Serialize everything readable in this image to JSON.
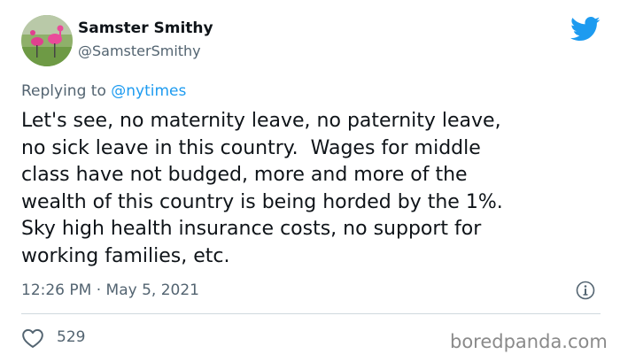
{
  "user": {
    "display_name": "Samster Smithy",
    "handle": "@SamsterSmithy"
  },
  "reply": {
    "prefix": "Replying to ",
    "mention": "@nytimes"
  },
  "tweet": {
    "text": "Let's see, no maternity leave, no paternity leave,\nno sick leave in this country.  Wages for middle\nclass have not budged, more and more of the\nwealth of this country is being horded by the 1%.\nSky high health insurance costs, no support for\nworking families, etc."
  },
  "meta": {
    "timestamp": "12:26 PM · May 5, 2021"
  },
  "stats": {
    "likes": "529"
  },
  "watermark": "boredpanda.com",
  "icons": {
    "brand": "twitter-bird-icon",
    "info": "info-icon",
    "like": "heart-icon"
  },
  "colors": {
    "twitter_blue": "#1d9bf0",
    "secondary_text": "#536471"
  }
}
